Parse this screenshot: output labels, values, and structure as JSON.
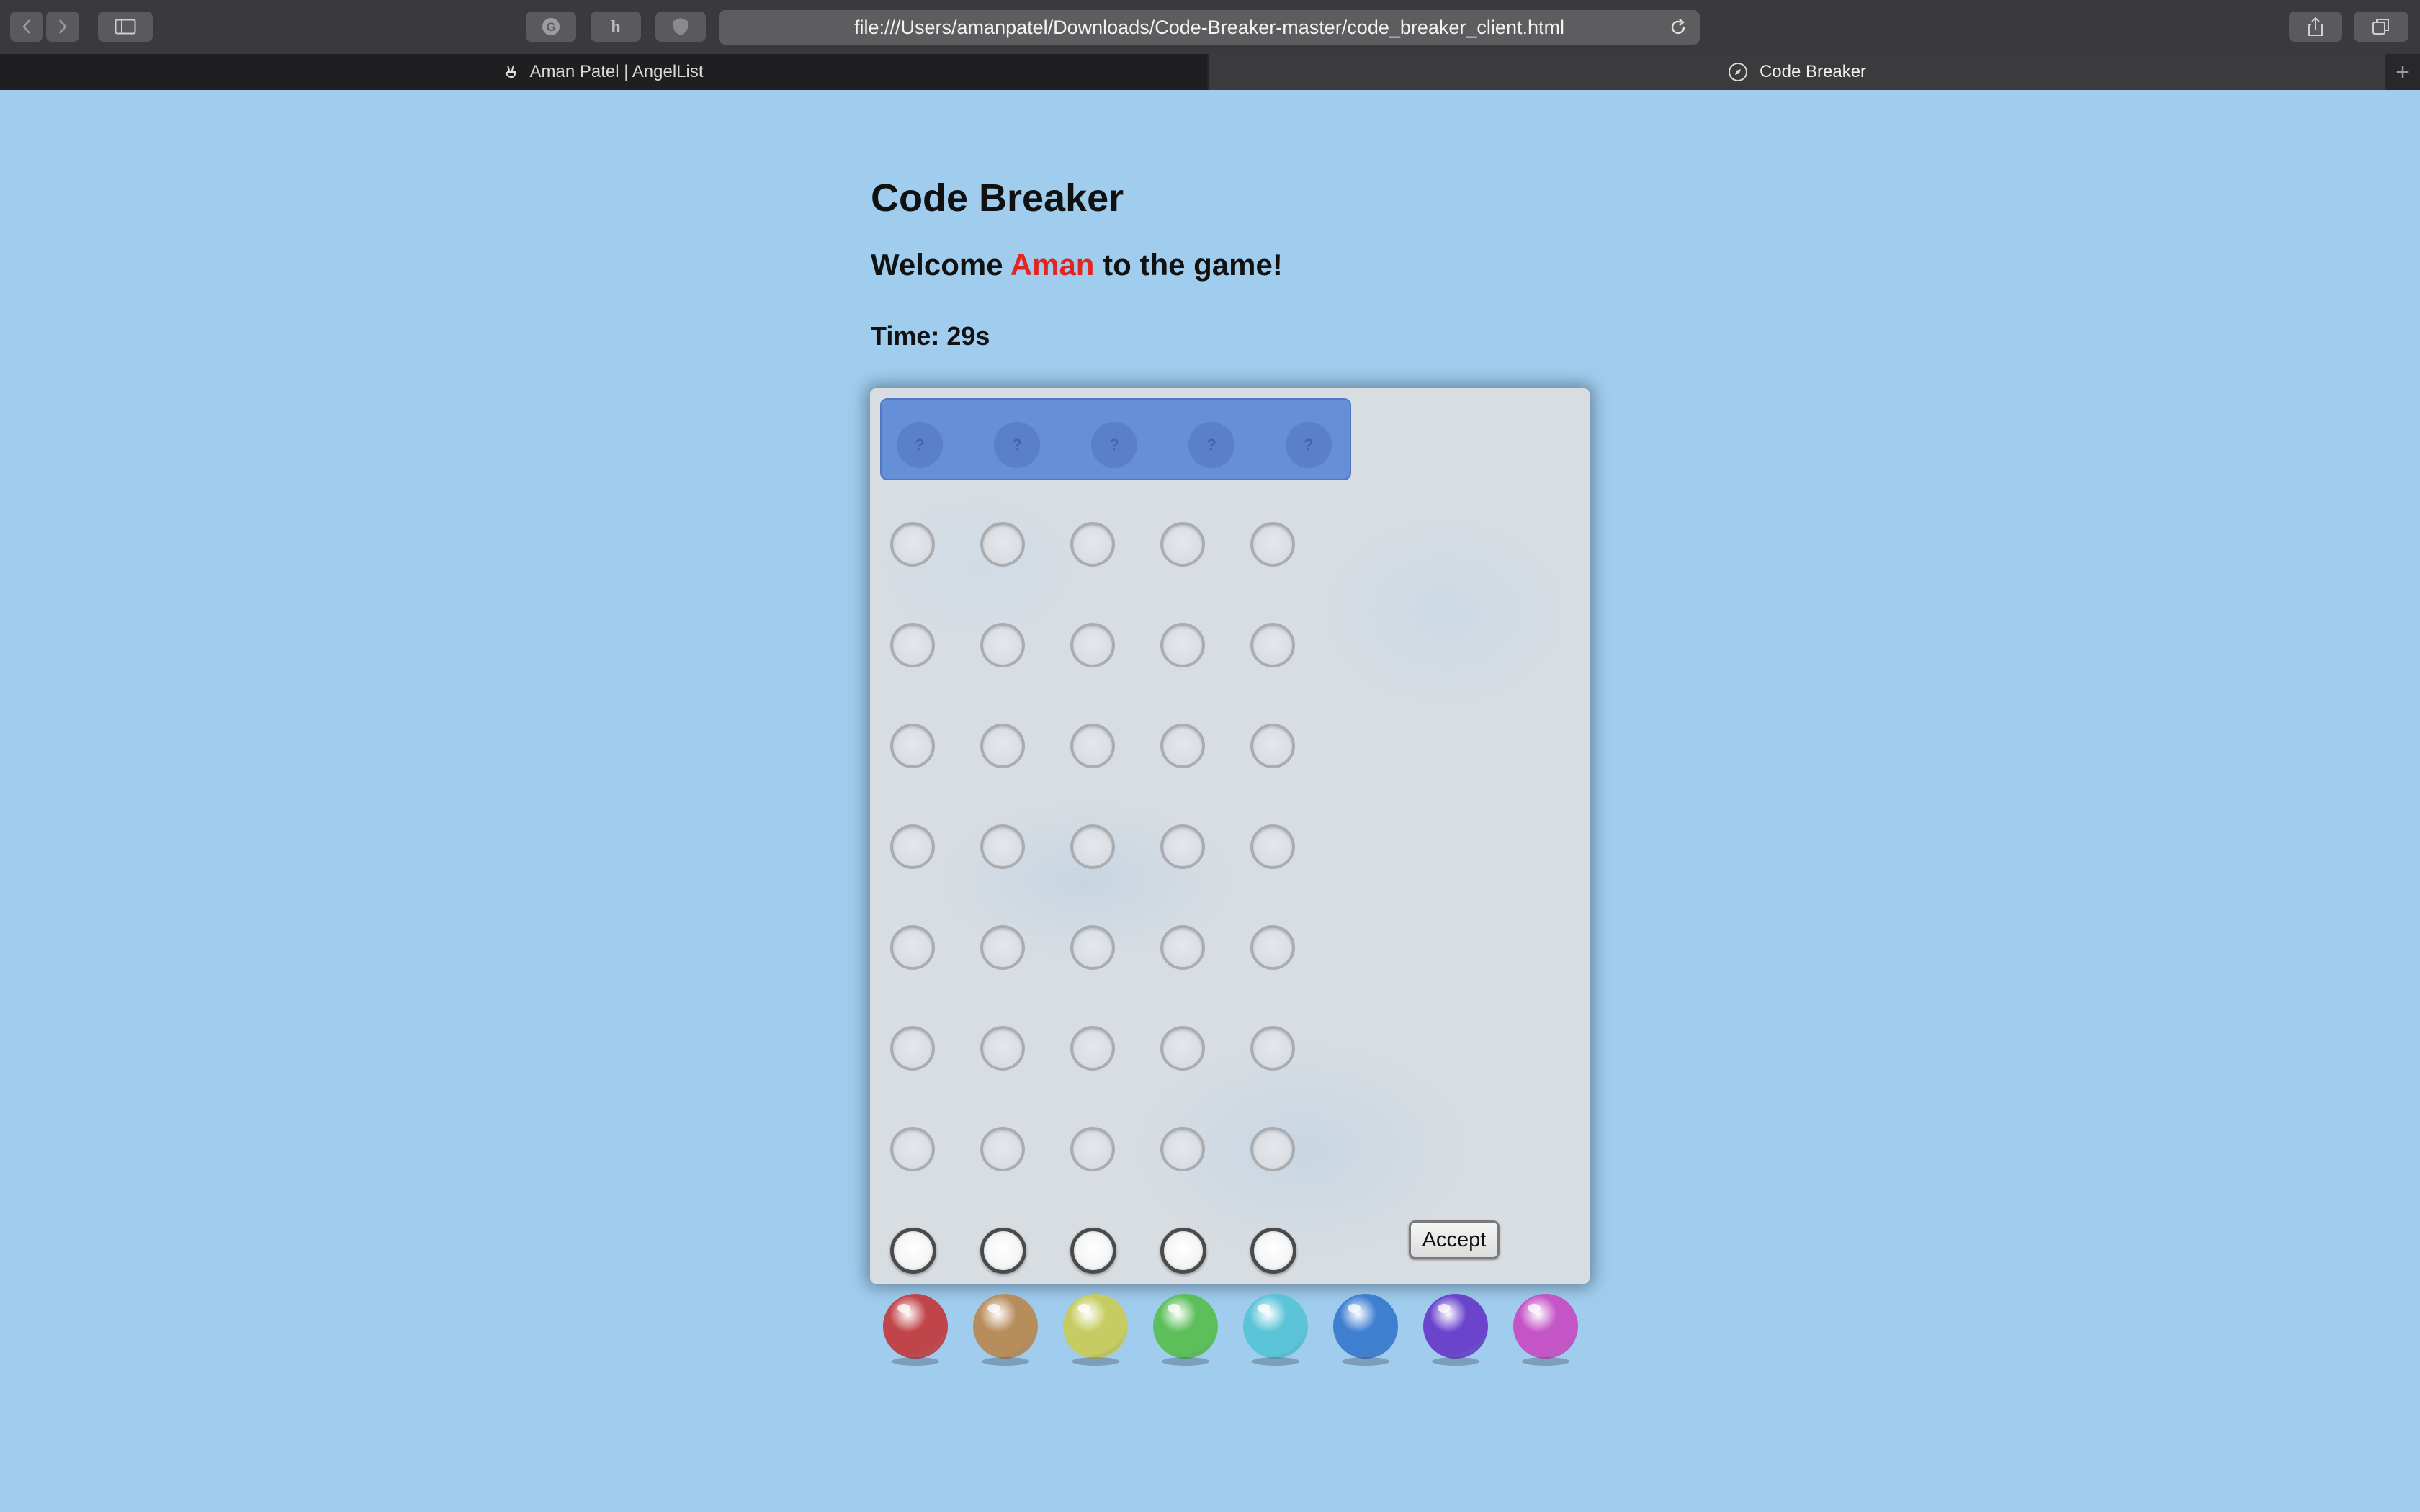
{
  "browser": {
    "url": "file:///Users/amanpatel/Downloads/Code-Breaker-master/code_breaker_client.html",
    "tabs": [
      {
        "label": "Aman Patel | AngelList",
        "active": false
      },
      {
        "label": "Code Breaker",
        "active": true
      }
    ]
  },
  "page": {
    "title": "Code Breaker",
    "welcome_prefix": "Welcome",
    "player_name": "Aman",
    "welcome_suffix": "to the game!",
    "timer": "Time: 29s"
  },
  "board": {
    "secret_placeholder": "?",
    "guess_rows": 8,
    "pegs_per_row": 5,
    "active_row": 8,
    "accept_label": "Accept"
  },
  "palette": [
    {
      "name": "red",
      "color": "#c0454a"
    },
    {
      "name": "tan",
      "color": "#b88d5c"
    },
    {
      "name": "yellow",
      "color": "#c6cc62"
    },
    {
      "name": "green",
      "color": "#5cbf5a"
    },
    {
      "name": "cyan",
      "color": "#5cc4d8"
    },
    {
      "name": "blue",
      "color": "#3f7fd0"
    },
    {
      "name": "purple",
      "color": "#6a45cc"
    },
    {
      "name": "magenta",
      "color": "#c555c6"
    }
  ]
}
